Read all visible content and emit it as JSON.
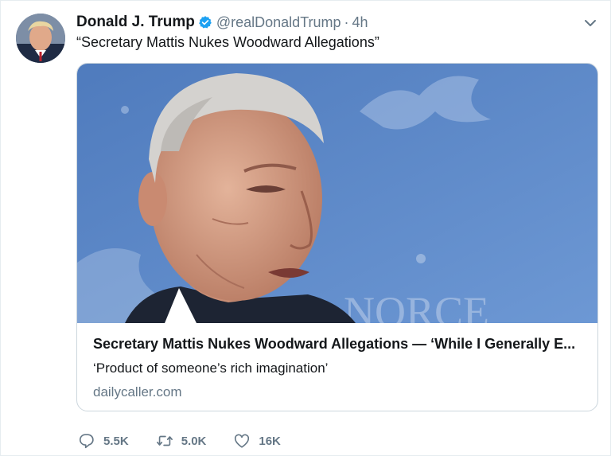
{
  "tweet": {
    "author_name": "Donald J. Trump",
    "handle": "@realDonaldTrump",
    "separator": "·",
    "time": "4h",
    "text": "“Secretary Mattis Nukes Woodward Allegations”",
    "verified": true
  },
  "card": {
    "title": "Secretary Mattis Nukes Woodward Allegations — ‘While I Generally E...",
    "description": "‘Product of someone’s rich imagination’",
    "domain": "dailycaller.com"
  },
  "actions": {
    "replies": "5.5K",
    "retweets": "5.0K",
    "likes": "16K"
  },
  "icons": {
    "verified": "verified-badge-icon",
    "caret": "chevron-down-icon",
    "reply": "reply-icon",
    "retweet": "retweet-icon",
    "like": "heart-icon"
  },
  "colors": {
    "verified_blue": "#1da1f2",
    "secondary_text": "#657786",
    "card_border": "#ccd6dd",
    "image_background": "#5b86c4"
  }
}
